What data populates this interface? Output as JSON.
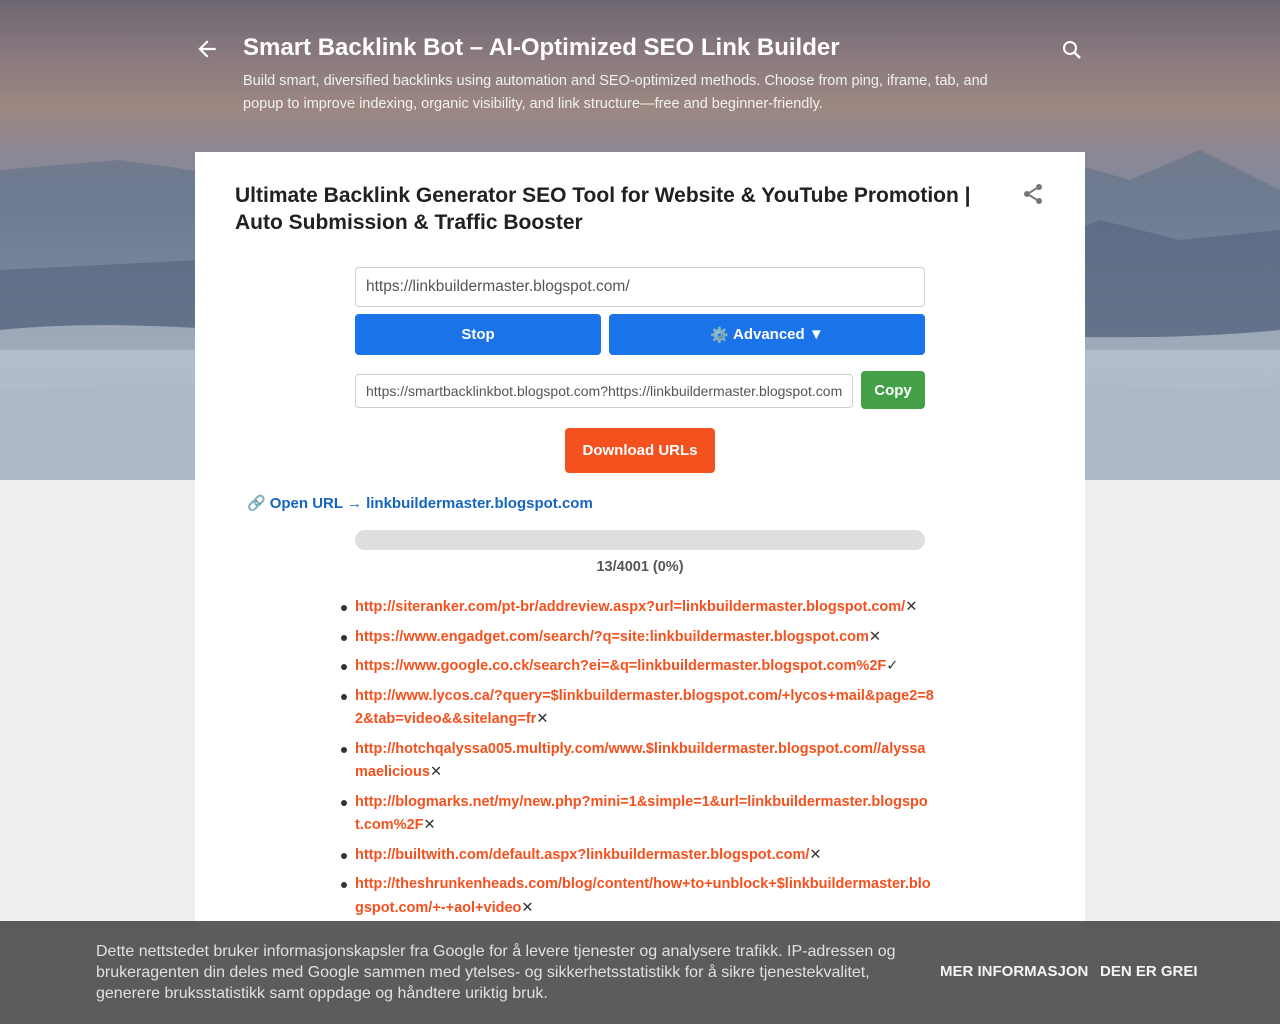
{
  "header": {
    "back_icon": "arrow-left-icon",
    "title": "Smart Backlink Bot – AI-Optimized SEO Link Builder",
    "description": "Build smart, diversified backlinks using automation and SEO-optimized methods. Choose from ping, iframe, tab, and popup to improve indexing, organic visibility, and link structure—free and beginner-friendly.",
    "search_icon": "search-icon"
  },
  "post": {
    "title": "Ultimate Backlink Generator SEO Tool for Website & YouTube Promotion | Auto Submission & Traffic Booster",
    "share_icon": "share-icon"
  },
  "tool": {
    "url_input_value": "https://linkbuildermaster.blogspot.com/",
    "stop_label": "Stop",
    "advanced_icon": "⚙️",
    "advanced_label": "Advanced ▼",
    "generated_url_value": "https://smartbacklinkbot.blogspot.com?https://linkbuildermaster.blogspot.com/",
    "copy_label": "Copy",
    "download_label": "Download URLs",
    "open_url_icon": "🔗",
    "open_url_label": "Open URL → linkbuildermaster.blogspot.com",
    "progress_fraction": 0,
    "progress_text": "13/4001 (0%)"
  },
  "url_list": [
    {
      "url": "http://siteranker.com/pt-br/addreview.aspx?url=linkbuildermaster.blogspot.com/",
      "status": "✕"
    },
    {
      "url": "https://www.engadget.com/search/?q=site:linkbuildermaster.blogspot.com",
      "status": "✕"
    },
    {
      "url": "https://www.google.co.ck/search?ei=&q=linkbuildermaster.blogspot.com%2F",
      "status": "✓"
    },
    {
      "url": "http://www.lycos.ca/?query=$linkbuildermaster.blogspot.com/+lycos+mail&page2=82&tab=video&&sitelang=fr",
      "status": "✕"
    },
    {
      "url": "http://hotchqalyssa005.multiply.com/www.$linkbuildermaster.blogspot.com//alyssamaelicious",
      "status": "✕"
    },
    {
      "url": "http://blogmarks.net/my/new.php?mini=1&simple=1&url=linkbuildermaster.blogspot.com%2F",
      "status": "✕"
    },
    {
      "url": "http://builtwith.com/default.aspx?linkbuildermaster.blogspot.com/",
      "status": "✕"
    },
    {
      "url": "http://theshrunkenheads.com/blog/content/how+to+unblock+$linkbuildermaster.blogspot.com/+-+aol+video",
      "status": "✕"
    }
  ],
  "cookie": {
    "text": "Dette nettstedet bruker informasjonskapsler fra Google for å levere tjenester og analysere trafikk. IP-adressen og brukeragenten din deles med Google sammen med ytelses- og sikkerhetsstatistikk for å sikre tjenestekvalitet, generere bruksstatistikk samt oppdage og håndtere uriktig bruk.",
    "more_info_label": "MER INFORMASJON",
    "ok_label": "DEN ER GREI"
  }
}
